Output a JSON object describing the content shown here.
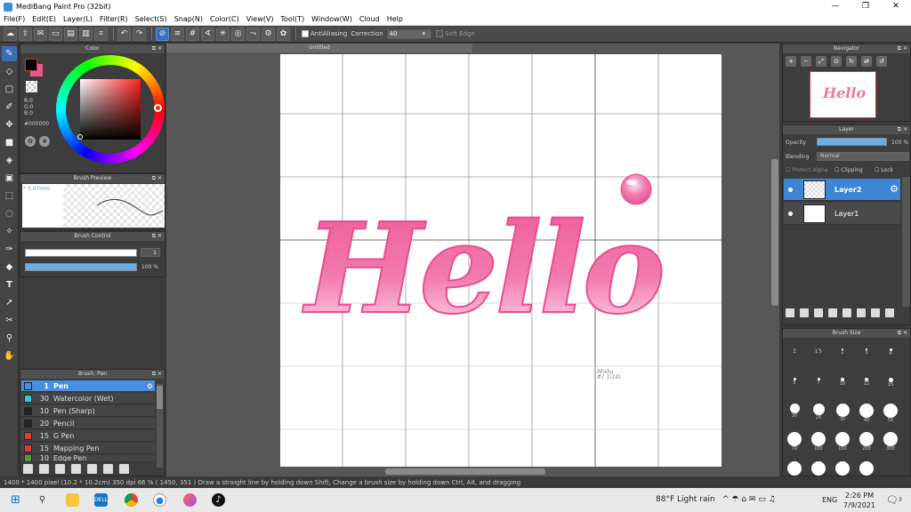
{
  "window": {
    "title": "MediBang Paint Pro (32bit)",
    "min": "—",
    "max": "❐",
    "close": "✕"
  },
  "menu": [
    "File(F)",
    "Edit(E)",
    "Layer(L)",
    "Filter(R)",
    "Select(S)",
    "Snap(N)",
    "Color(C)",
    "View(V)",
    "Tool(T)",
    "Window(W)",
    "Cloud",
    "Help"
  ],
  "toolbar": {
    "antialiasing_label": "AntiAliasing",
    "correction_label": "Correction",
    "correction_value": "40",
    "soft_edge_label": "Soft Edge"
  },
  "color_panel": {
    "title": "Color",
    "r": "R:0",
    "g": "G:0",
    "b": "B:0",
    "hex": "#000000",
    "fg_color": "#000000",
    "bg_color": "#e7598f"
  },
  "brush_preview": {
    "title": "Brush Preview",
    "size": "* 0.07mm"
  },
  "brush_control": {
    "title": "Brush Control",
    "size_value": "1",
    "opacity_value": "100 %"
  },
  "brush_list": {
    "title": "Brush: Pen",
    "items": [
      {
        "num": "1",
        "name": "Pen",
        "color": "#4a8ee0",
        "active": true
      },
      {
        "num": "30",
        "name": "Watercolor (Wet)",
        "color": "#2ecbe8"
      },
      {
        "num": "10",
        "name": "Pen (Sharp)",
        "color": "#222222"
      },
      {
        "num": "20",
        "name": "Pencil",
        "color": "#222222"
      },
      {
        "num": "15",
        "name": "G Pen",
        "color": "#e53935"
      },
      {
        "num": "15",
        "name": "Mapping Pen",
        "color": "#e53935"
      },
      {
        "num": "10",
        "name": "Edge Pen",
        "color": "#43a047"
      }
    ]
  },
  "document": {
    "tab": "Untitled",
    "artwork_text": "Hello",
    "signature_line1": "Misha",
    "signature_line2": "#1 1(24)"
  },
  "navigator": {
    "title": "Navigator",
    "thumb_text": "Hello"
  },
  "layer_panel": {
    "title": "Layer",
    "opacity_label": "Opacity",
    "opacity_value": "100 %",
    "blending_label": "Blending",
    "blending_value": "Normal",
    "protect_alpha": "Protect Alpha",
    "clipping": "Clipping",
    "lock": "Lock",
    "layers": [
      {
        "name": "Layer2",
        "active": true
      },
      {
        "name": "Layer1",
        "active": false
      }
    ]
  },
  "brush_size": {
    "title": "Brush Size",
    "rows": [
      [
        "1",
        "1.5",
        "2",
        "3",
        "4"
      ],
      [
        "5",
        "7",
        "10",
        "12",
        "15"
      ],
      [
        "20",
        "25",
        "30",
        "40",
        "50"
      ],
      [
        "70",
        "100",
        "150",
        "200",
        "300"
      ]
    ]
  },
  "status": {
    "text": "1400 * 1400 pixel  (10.2 * 10.2cm)  350 dpi  66 %  ( 1450, 351 )  Draw a straight line by holding down Shift, Change a brush size by holding down Ctrl, Alt, and dragging"
  },
  "taskbar": {
    "weather": "88°F  Light rain",
    "lang": "ENG",
    "time": "2:26 PM",
    "date": "7/9/2021",
    "notif_count": "3"
  },
  "colors": {
    "accent": "#3d86d6",
    "pink": "#ef5a98"
  }
}
